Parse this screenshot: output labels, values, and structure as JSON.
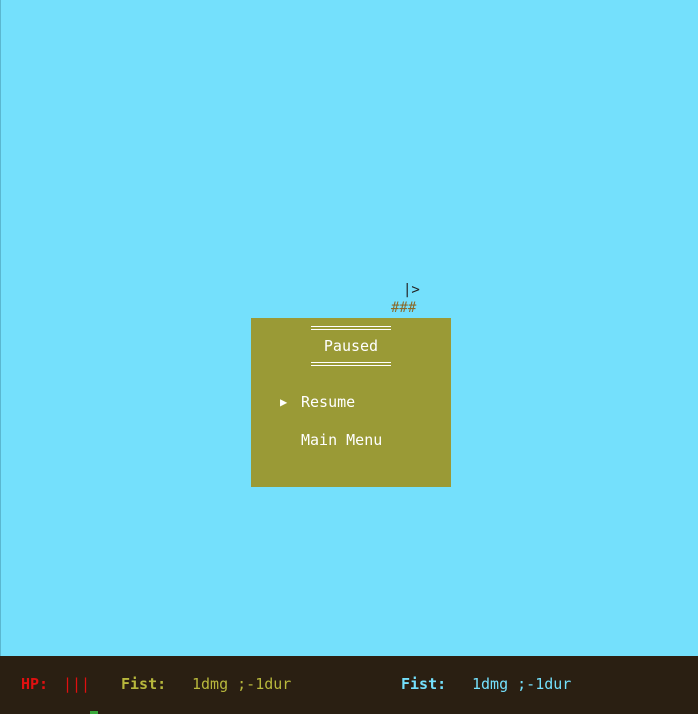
{
  "scene": {
    "player_glyph": "|>",
    "platform_glyph": "###"
  },
  "pause_menu": {
    "title": "Paused",
    "selector": "▶",
    "items": [
      {
        "label": "Resume",
        "selected": true
      },
      {
        "label": "Main Menu",
        "selected": false
      }
    ]
  },
  "hud": {
    "hp_label": "HP:",
    "hp_bars": "|||",
    "weapon_left": {
      "name": "Fist:",
      "stats": "1dmg ;-1dur"
    },
    "weapon_right": {
      "name": "Fist:",
      "stats": "1dmg ;-1dur"
    }
  },
  "colors": {
    "sky": "#74e0fc",
    "panel": "#9a9a36",
    "hud_bg": "#2a1f12",
    "hp": "#e01010",
    "weapon_left": "#b8b83c",
    "weapon_right": "#74e0fc"
  }
}
